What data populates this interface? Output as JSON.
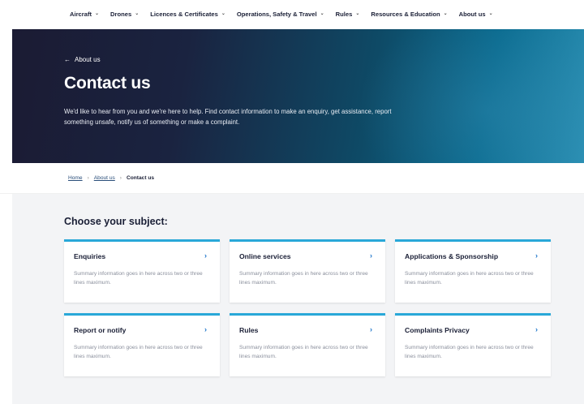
{
  "nav": {
    "items": [
      {
        "label": "Aircraft"
      },
      {
        "label": "Drones"
      },
      {
        "label": "Licences & Certificates"
      },
      {
        "label": "Operations, Safety & Travel"
      },
      {
        "label": "Rules"
      },
      {
        "label": "Resources & Education"
      },
      {
        "label": "About us"
      }
    ]
  },
  "hero": {
    "back_label": "About us",
    "title": "Contact us",
    "description": "We'd like to hear from you and we're here to help. Find contact information to make an enquiry, get assistance, report something unsafe, notify us of something or make a complaint."
  },
  "breadcrumb": {
    "home": "Home",
    "parent": "About us",
    "current": "Contact us"
  },
  "main": {
    "section_title": "Choose your subject:",
    "cards": [
      {
        "title": "Enquiries",
        "summary": "Summary information goes in here across two or three lines maximum."
      },
      {
        "title": "Online services",
        "summary": "Summary information goes in here across two or three lines maximum."
      },
      {
        "title": "Applications & Sponsorship",
        "summary": "Summary information goes in here across two or three lines maximum."
      },
      {
        "title": "Report or notify",
        "summary": "Summary information goes in here across two or three lines maximum."
      },
      {
        "title": "Rules",
        "summary": "Summary information goes in here across two or three lines maximum."
      },
      {
        "title": "Complaints Privacy",
        "summary": "Summary information goes in here across two or three lines maximum."
      }
    ]
  },
  "colors": {
    "accent": "#29a8d8",
    "link": "#1a73c9",
    "hero_dark": "#1b1b33",
    "hero_teal": "#0a6b8f"
  },
  "icons": {
    "nav_dropdown": "chevron-down-icon",
    "back": "arrow-left-icon",
    "card": "chevron-right-icon"
  }
}
